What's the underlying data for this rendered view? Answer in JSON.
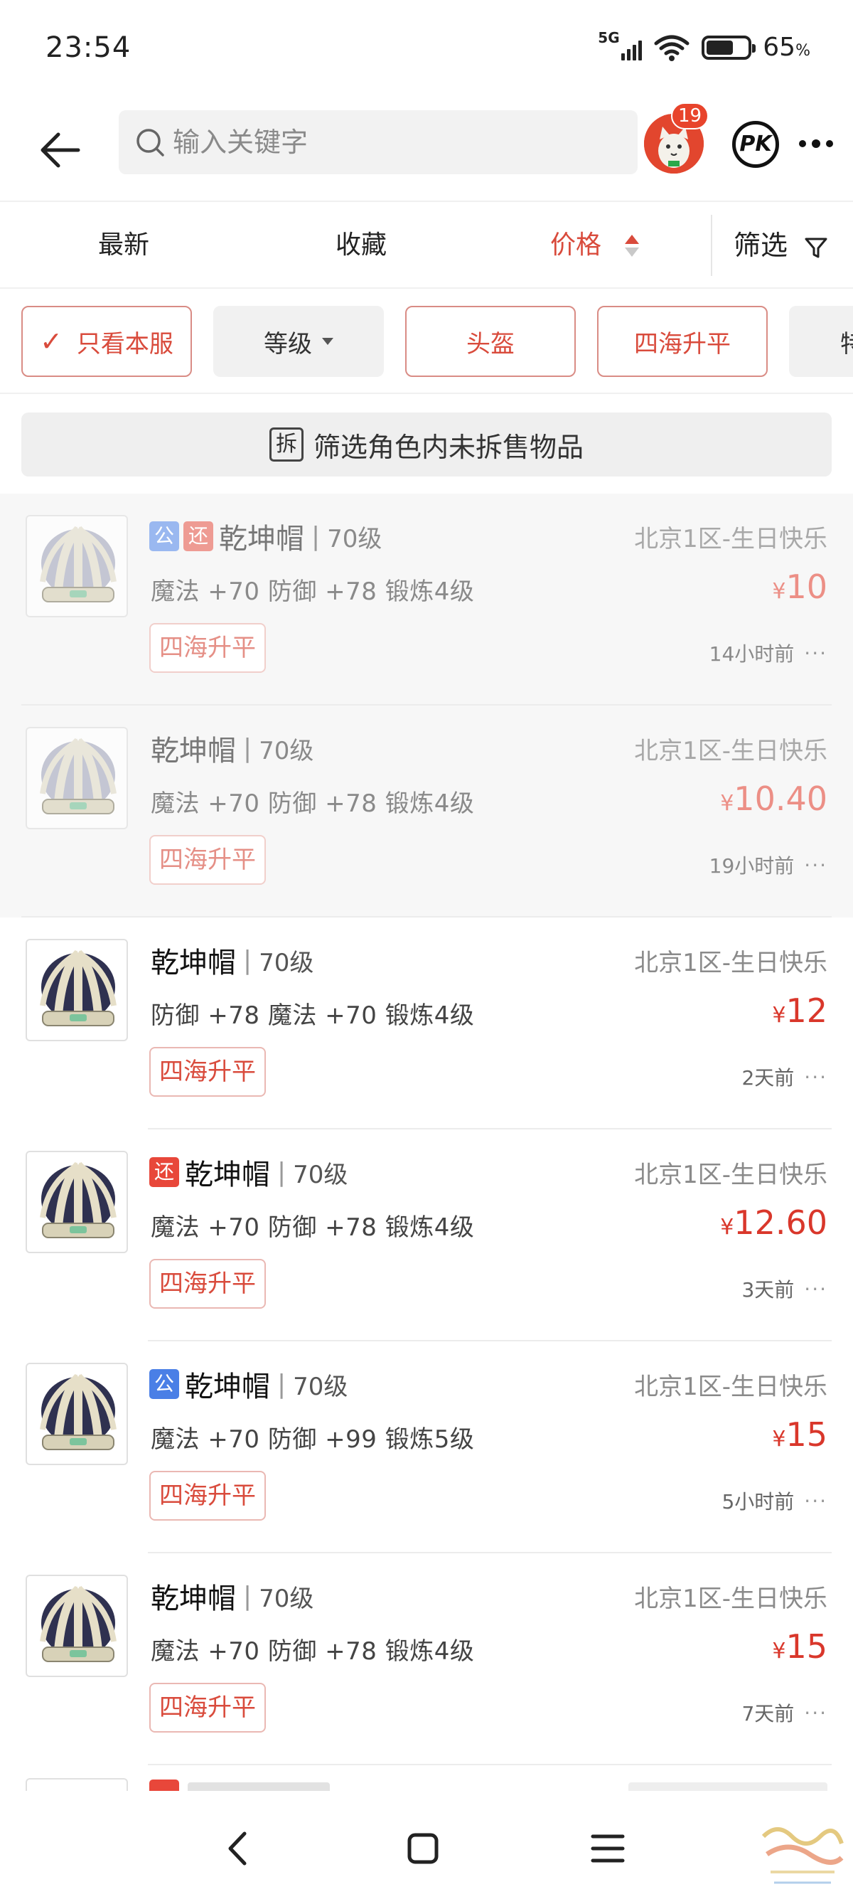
{
  "status": {
    "time": "23:54",
    "network": "5G",
    "battery": "65",
    "battery_unit": "%",
    "battery_level": 0.65
  },
  "header": {
    "search_placeholder": "输入关键字",
    "notification_count": "19",
    "pk_label": "PK"
  },
  "sort": {
    "newest": "最新",
    "favorites": "收藏",
    "price": "价格",
    "filter": "筛选"
  },
  "chips": {
    "own_server": "只看本服",
    "level": "等级",
    "helmet": "头盔",
    "set": "四海升平",
    "partial": "特"
  },
  "split_banner": {
    "icon": "拆",
    "text": "筛选角色内未拆售物品"
  },
  "colors": {
    "accent": "#d94b3c",
    "tag_public": "#4a7fe6",
    "tag_return": "#e8473a"
  },
  "items": [
    {
      "tags": [
        "公",
        "还"
      ],
      "name": "乾坤帽",
      "sep": "|",
      "level": "70级",
      "server": "北京1区-生日快乐",
      "attrs": "魔法 +70 防御 +78 锻炼4级",
      "price": "10",
      "set": "四海升平",
      "time": "14小时前",
      "dim": true
    },
    {
      "tags": [],
      "name": "乾坤帽",
      "sep": "|",
      "level": "70级",
      "server": "北京1区-生日快乐",
      "attrs": "魔法 +70 防御 +78 锻炼4级",
      "price": "10.40",
      "set": "四海升平",
      "time": "19小时前",
      "dim": true
    },
    {
      "tags": [],
      "name": "乾坤帽",
      "sep": "|",
      "level": "70级",
      "server": "北京1区-生日快乐",
      "attrs": "防御 +78 魔法 +70 锻炼4级",
      "price": "12",
      "set": "四海升平",
      "time": "2天前",
      "dim": false
    },
    {
      "tags": [
        "还"
      ],
      "name": "乾坤帽",
      "sep": "|",
      "level": "70级",
      "server": "北京1区-生日快乐",
      "attrs": "魔法 +70 防御 +78 锻炼4级",
      "price": "12.60",
      "set": "四海升平",
      "time": "3天前",
      "dim": false
    },
    {
      "tags": [
        "公"
      ],
      "name": "乾坤帽",
      "sep": "|",
      "level": "70级",
      "server": "北京1区-生日快乐",
      "attrs": "魔法 +70 防御 +99 锻炼5级",
      "price": "15",
      "set": "四海升平",
      "time": "5小时前",
      "dim": false
    },
    {
      "tags": [],
      "name": "乾坤帽",
      "sep": "|",
      "level": "70级",
      "server": "北京1区-生日快乐",
      "attrs": "魔法 +70 防御 +78 锻炼4级",
      "price": "15",
      "set": "四海升平",
      "time": "7天前",
      "dim": false
    }
  ],
  "currency": "¥",
  "more_dots": "···"
}
